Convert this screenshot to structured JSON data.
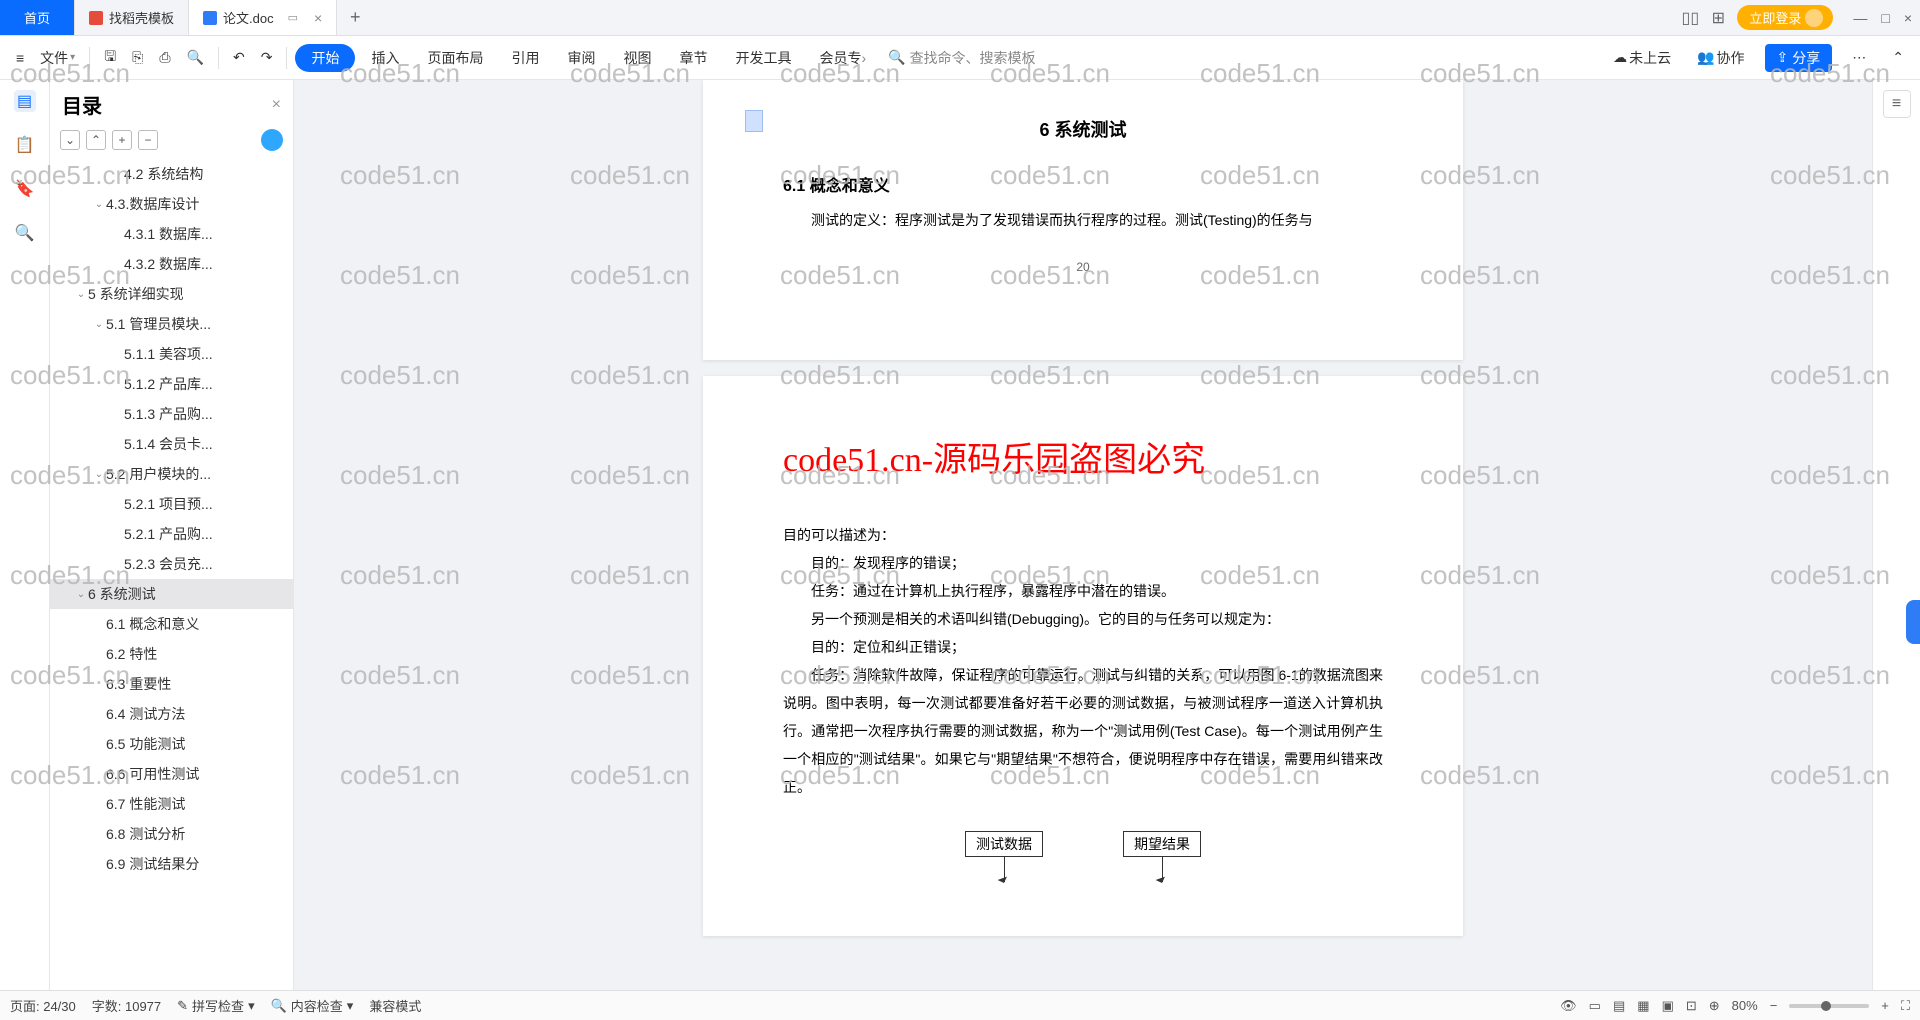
{
  "tabs": {
    "home": "首页",
    "template": "找稻壳模板",
    "doc": "论文.doc"
  },
  "login": "立即登录",
  "menu": {
    "file": "文件",
    "start": "开始",
    "insert": "插入",
    "layout": "页面布局",
    "ref": "引用",
    "review": "审阅",
    "view": "视图",
    "chapter": "章节",
    "dev": "开发工具",
    "vip": "会员专",
    "search": "查找命令、搜索模板",
    "cloud": "未上云",
    "collab": "协作",
    "share": "分享"
  },
  "nav": {
    "title": "目录",
    "items": [
      {
        "t": "4.2 系统结构",
        "lv": 3
      },
      {
        "t": "4.3.数据库设计",
        "lv": 2,
        "c": true
      },
      {
        "t": "4.3.1 数据库...",
        "lv": 3
      },
      {
        "t": "4.3.2 数据库...",
        "lv": 3
      },
      {
        "t": "5 系统详细实现",
        "lv": 1,
        "c": true
      },
      {
        "t": "5.1 管理员模块...",
        "lv": 2,
        "c": true
      },
      {
        "t": "5.1.1 美容项...",
        "lv": 3
      },
      {
        "t": "5.1.2 产品库...",
        "lv": 3
      },
      {
        "t": "5.1.3 产品购...",
        "lv": 3
      },
      {
        "t": "5.1.4 会员卡...",
        "lv": 3
      },
      {
        "t": "5.2 用户模块的...",
        "lv": 2,
        "c": true
      },
      {
        "t": "5.2.1 项目预...",
        "lv": 3
      },
      {
        "t": "5.2.1 产品购...",
        "lv": 3
      },
      {
        "t": "5.2.3 会员充...",
        "lv": 3
      },
      {
        "t": "6 系统测试",
        "lv": 1,
        "c": true,
        "sel": true
      },
      {
        "t": "6.1 概念和意义",
        "lv": 2
      },
      {
        "t": "6.2 特性",
        "lv": 2
      },
      {
        "t": "6.3 重要性",
        "lv": 2
      },
      {
        "t": "6.4 测试方法",
        "lv": 2
      },
      {
        "t": "6.5 功能测试",
        "lv": 2
      },
      {
        "t": "6.6 可用性测试",
        "lv": 2
      },
      {
        "t": "6.7 性能测试",
        "lv": 2
      },
      {
        "t": "6.8 测试分析",
        "lv": 2
      },
      {
        "t": "6.9 测试结果分",
        "lv": 2
      }
    ]
  },
  "doc": {
    "h": "6 系统测试",
    "s1": "6.1 概念和意义",
    "p1": "测试的定义：程序测试是为了发现错误而执行程序的过程。测试(Testing)的任务与",
    "pg": "20",
    "banner": "code51.cn-源码乐园盗图必究",
    "p2": "目的可以描述为：",
    "p3": "目的：发现程序的错误；",
    "p4": "任务：通过在计算机上执行程序，暴露程序中潜在的错误。",
    "p5": "另一个预测是相关的术语叫纠错(Debugging)。它的目的与任务可以规定为：",
    "p6": "目的：定位和纠正错误；",
    "p7": "任务：消除软件故障，保证程序的可靠运行。测试与纠错的关系，可以用图 6-1的数据流图来说明。图中表明，每一次测试都要准备好若干必要的测试数据，与被测试程序一道送入计算机执行。通常把一次程序执行需要的测试数据，称为一个\"测试用例(Test Case)。每一个测试用例产生一个相应的\"测试结果\"。如果它与\"期望结果\"不想符合，便说明程序中存在错误，需要用纠错来改正。",
    "f1": "测试数据",
    "f2": "期望结果"
  },
  "status": {
    "page": "页面: 24/30",
    "words": "字数: 10977",
    "spell": "拼写检查",
    "content": "内容检查",
    "compat": "兼容模式",
    "zoom": "80%"
  },
  "watermark": "code51.cn"
}
